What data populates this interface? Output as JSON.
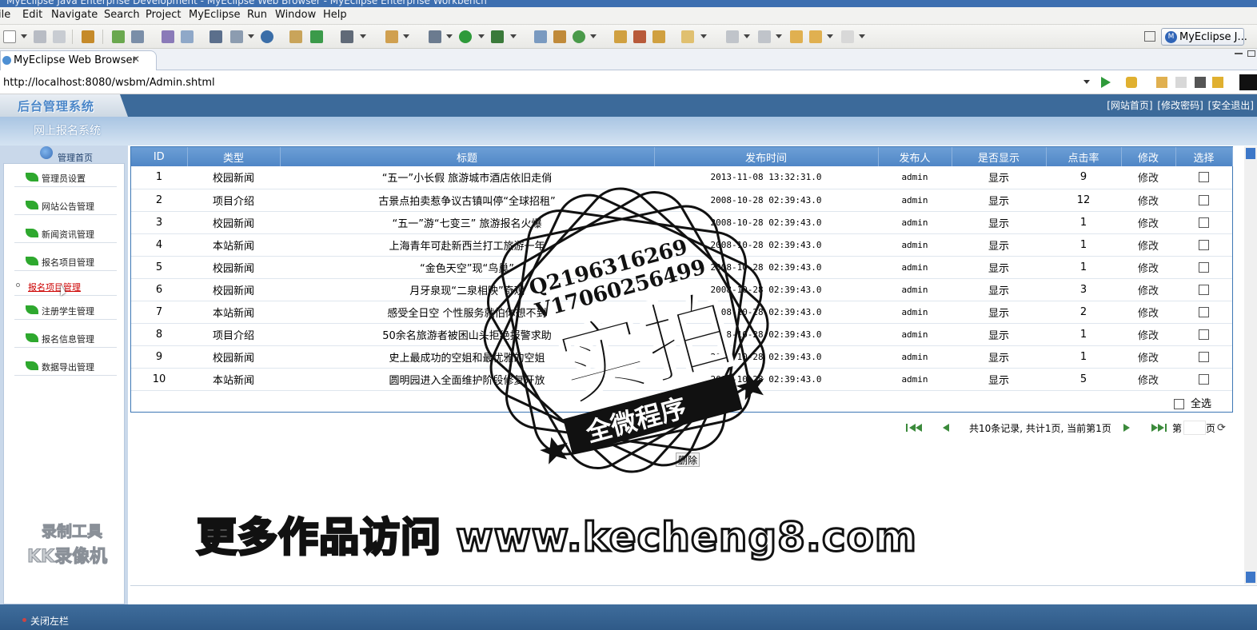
{
  "window": {
    "title": "MyEclipse Java Enterprise Development - MyEclipse Web Browser - MyEclipse Enterprise Workbench"
  },
  "menu": [
    "ile",
    "Edit",
    "Navigate",
    "Search",
    "Project",
    "MyEclipse",
    "Run",
    "Window",
    "Help"
  ],
  "perspective": {
    "label": "MyEclipse J..."
  },
  "editor_tab": {
    "label": "MyEclipse Web Browser",
    "close": "✕"
  },
  "address": {
    "url": "http://localhost:8080/wsbm/Admin.shtml"
  },
  "admin": {
    "logo": "后台管理系统",
    "links": [
      "[网站首页]",
      "[修改密码]",
      "[安全退出]"
    ],
    "subtitle": "网上报名系统"
  },
  "sidebar": {
    "home": "管理首页",
    "items": [
      {
        "label": "管理员设置"
      },
      {
        "label": "网站公告管理"
      },
      {
        "label": "新闻资讯管理"
      },
      {
        "label": "报名项目管理"
      },
      {
        "label": "报名项目管理"
      },
      {
        "label": "注册学生管理"
      },
      {
        "label": "报名信息管理"
      },
      {
        "label": "数据导出管理"
      }
    ],
    "footer": "关闭左栏"
  },
  "table": {
    "headers": [
      "ID",
      "类型",
      "标题",
      "发布时间",
      "发布人",
      "是否显示",
      "点击率",
      "修改",
      "选择"
    ],
    "rows": [
      [
        "1",
        "校园新闻",
        "“五一”小长假 旅游城市酒店依旧走俏",
        "2013-11-08 13:32:31.0",
        "admin",
        "显示",
        "9",
        "修改"
      ],
      [
        "2",
        "项目介绍",
        "古景点拍卖惹争议古镇叫停“全球招租”",
        "2008-10-28 02:39:43.0",
        "admin",
        "显示",
        "12",
        "修改"
      ],
      [
        "3",
        "校园新闻",
        "“五一”游“七变三” 旅游报名火爆",
        "2008-10-28 02:39:43.0",
        "admin",
        "显示",
        "1",
        "修改"
      ],
      [
        "4",
        "本站新闻",
        "上海青年可赴新西兰打工旅游一年",
        "2008-10-28 02:39:43.0",
        "admin",
        "显示",
        "1",
        "修改"
      ],
      [
        "5",
        "校园新闻",
        "“金色天空”现“鸟巢”",
        "2008-10-28 02:39:43.0",
        "admin",
        "显示",
        "1",
        "修改"
      ],
      [
        "6",
        "校园新闻",
        "月牙泉现“二泉相映”奇观",
        "2008-10-28 02:39:43.0",
        "admin",
        "显示",
        "3",
        "修改"
      ],
      [
        "7",
        "本站新闻",
        "感受全日空 个性服务就怕你想不到",
        "2008-10-28 02:39:43.0",
        "admin",
        "显示",
        "2",
        "修改"
      ],
      [
        "8",
        "项目介绍",
        "50余名旅游者被困山头拒绝报警求助",
        "2008-10-28 02:39:43.0",
        "admin",
        "显示",
        "1",
        "修改"
      ],
      [
        "9",
        "校园新闻",
        "史上最成功的空姐和最优雅的空姐",
        "2008-10-28 02:39:43.0",
        "admin",
        "显示",
        "1",
        "修改"
      ],
      [
        "10",
        "本站新闻",
        "圆明园进入全面维护阶段修复开放",
        "2008-10-28 02:39:43.0",
        "admin",
        "显示",
        "5",
        "修改"
      ]
    ],
    "select_all": "全选"
  },
  "pager": {
    "summary": "共10条记录, 共计1页, 当前第1页",
    "page_prefix": "第",
    "page_suffix": "页",
    "page_value": ""
  },
  "delete_button": "删除",
  "watermarks": {
    "recorder_line1": "录制工具",
    "recorder_line2": "KK录像机",
    "url_banner": "更多作品访问 www.kecheng8.com",
    "stamp_qq": "Q2196316269",
    "stamp_v": "V17060256499",
    "stamp_main": "实拍",
    "stamp_ribbon": "全微程序"
  }
}
